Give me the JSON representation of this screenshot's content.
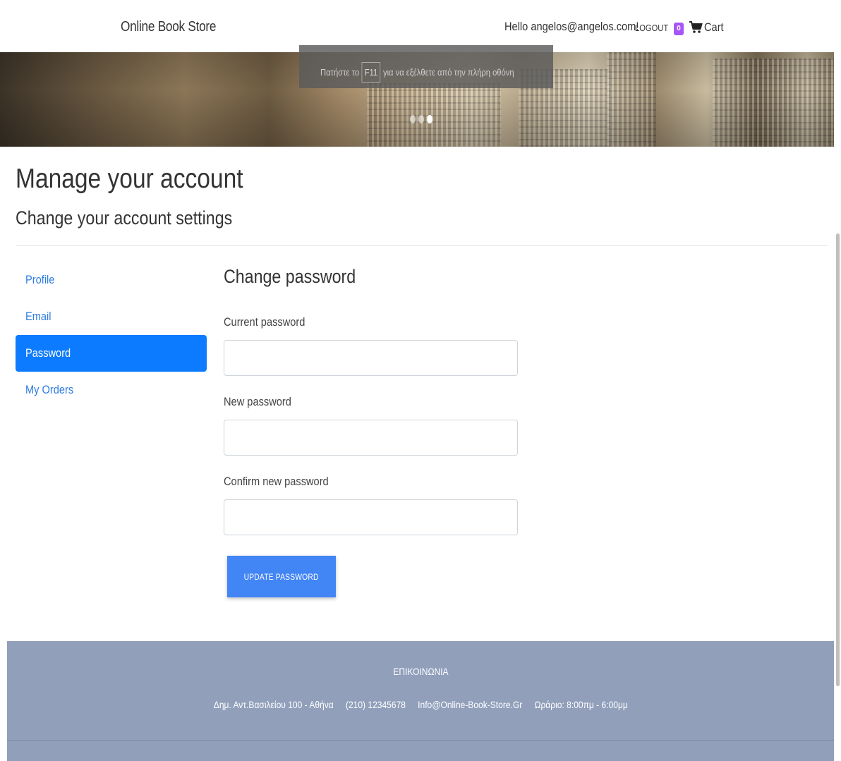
{
  "navbar": {
    "brand": "Online Book Store",
    "greeting_prefix": "Hello ",
    "user_email": "angelos@angelos.com",
    "greeting_suffix": "!",
    "logout_label": "LOGOUT",
    "cart_count": "0",
    "cart_label": "Cart",
    "badge_color": "#a855f7"
  },
  "banner": {
    "fullscreen_hint_before": "Πατήστε το",
    "fullscreen_hint_key": "F11",
    "fullscreen_hint_after": "για να εξέλθετε από την πλήρη οθόνη",
    "slide_count": 3,
    "active_slide": 3
  },
  "page": {
    "title": "Manage your account",
    "subtitle": "Change your account settings"
  },
  "sidenav": {
    "items": [
      {
        "label": "Profile",
        "active": false
      },
      {
        "label": "Email",
        "active": false
      },
      {
        "label": "Password",
        "active": true
      },
      {
        "label": "My Orders",
        "active": false
      }
    ],
    "active_color": "#0d7bff",
    "link_color": "#2f7de1"
  },
  "form": {
    "title": "Change password",
    "current_password_label": "Current password",
    "current_password_value": "",
    "new_password_label": "New password",
    "new_password_value": "",
    "confirm_password_label": "Confirm new password",
    "confirm_password_value": "",
    "submit_label": "UPDATE PASSWORD",
    "button_color": "#4285f4"
  },
  "footer": {
    "title": "ΕΠΙΚΟΙΝΩΝΙΑ",
    "address": "Δημ. Αντ.Βασιλείου 100 - Αθήνα",
    "phone": "(210) 12345678",
    "email": "Info@Online-Book-Store.Gr",
    "hours": "Ωράριο: 8:00πμ - 6:00μμ",
    "background_color": "#919fbb"
  }
}
